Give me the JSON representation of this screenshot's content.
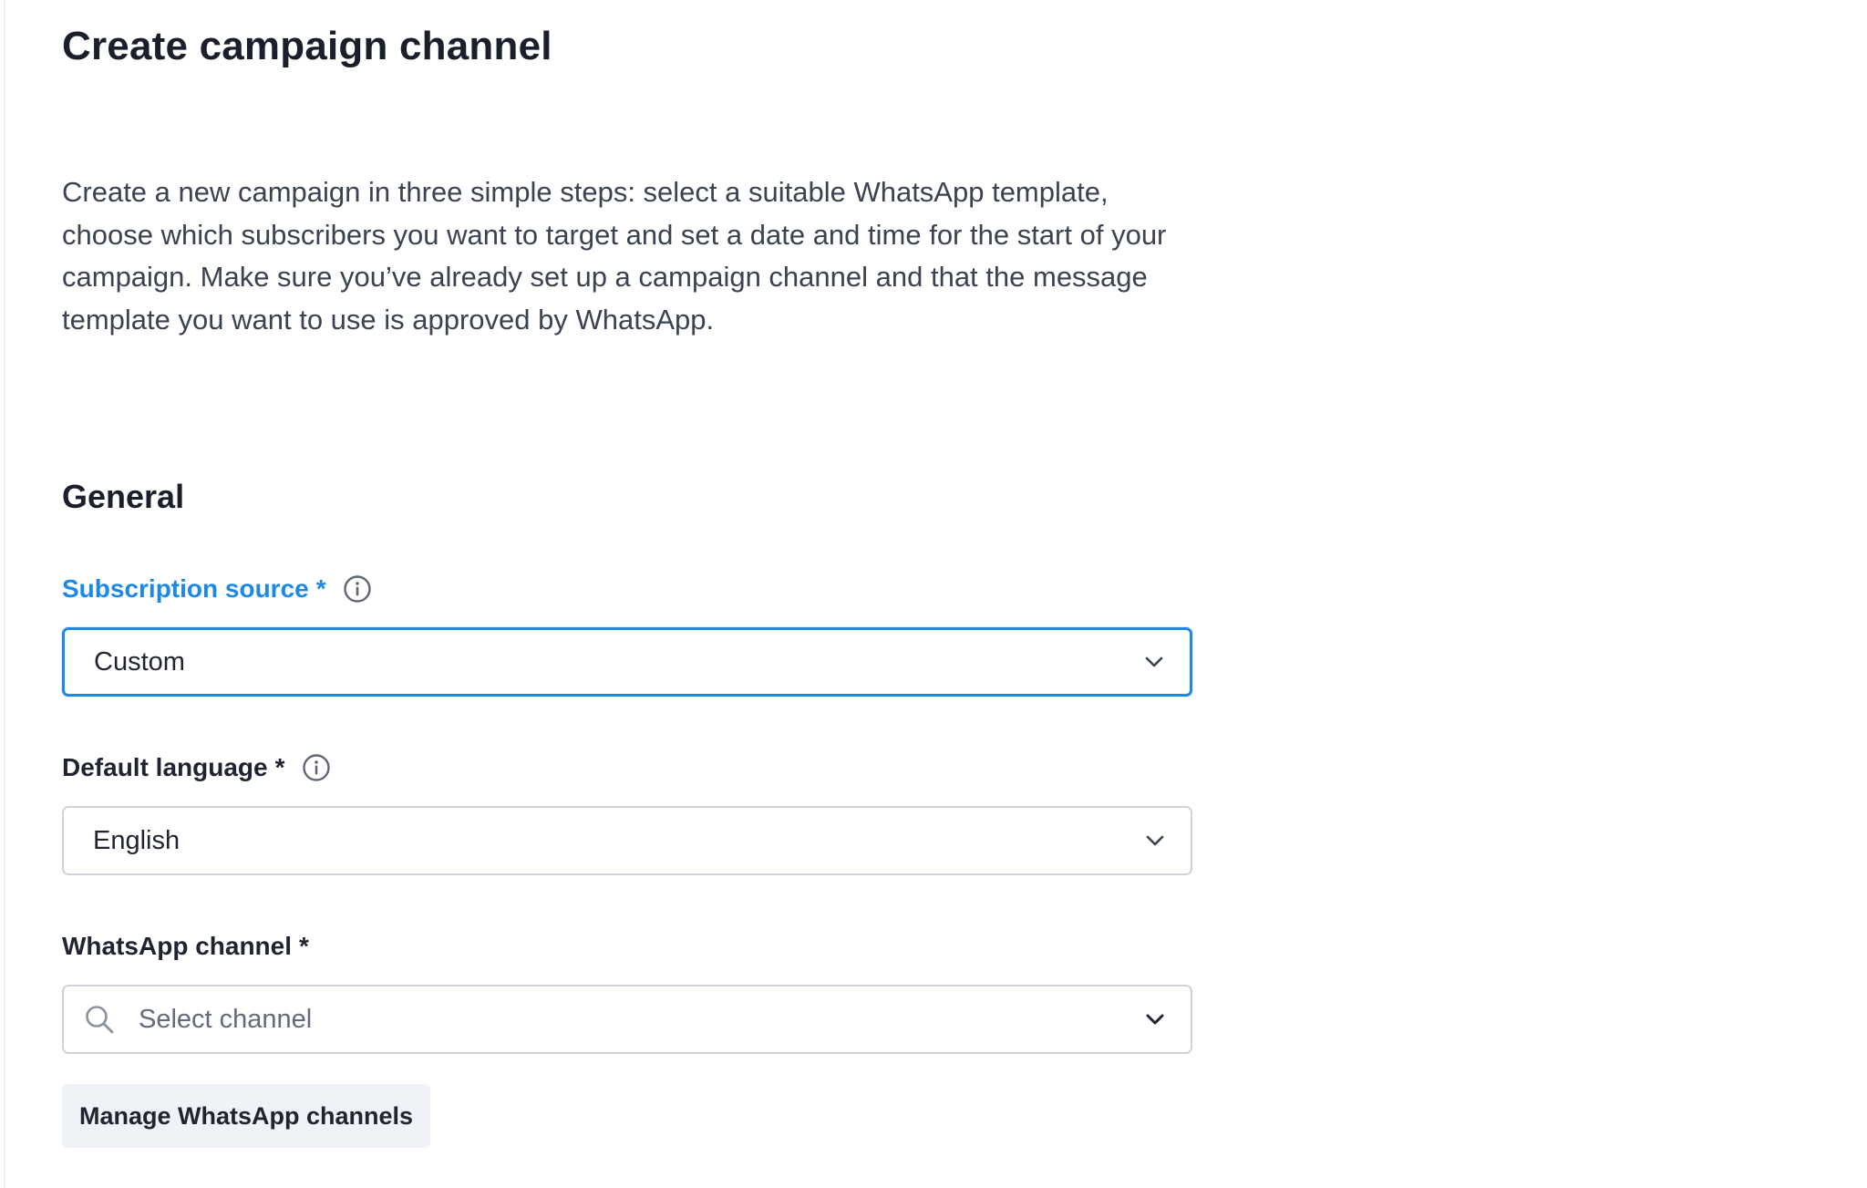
{
  "page": {
    "title": "Create campaign channel",
    "description": "Create a new campaign in three simple steps: select a suitable WhatsApp template, choose which subscribers you want to target and set a date and time for the start of your campaign. Make sure you’ve already set up a campaign channel and that the message template you want to use is approved by WhatsApp."
  },
  "general": {
    "section_title": "General",
    "subscription_source": {
      "label": "Subscription source",
      "required_mark": "*",
      "value": "Custom",
      "info_icon": "info-circle-icon",
      "chevron_icon": "chevron-down-icon"
    },
    "default_language": {
      "label": "Default language",
      "required_mark": "*",
      "value": "English",
      "info_icon": "info-circle-icon",
      "chevron_icon": "chevron-down-icon"
    },
    "whatsapp_channel": {
      "label": "WhatsApp channel",
      "required_mark": "*",
      "placeholder": "Select channel",
      "search_icon": "search-icon",
      "chevron_icon": "chevron-down-icon"
    },
    "manage_button_label": "Manage WhatsApp channels"
  },
  "colors": {
    "accent": "#1e88e5",
    "text_primary": "#1a1f2b",
    "text_body": "#3b4350",
    "border": "#cfd4da",
    "button_bg": "#eff3f7"
  }
}
